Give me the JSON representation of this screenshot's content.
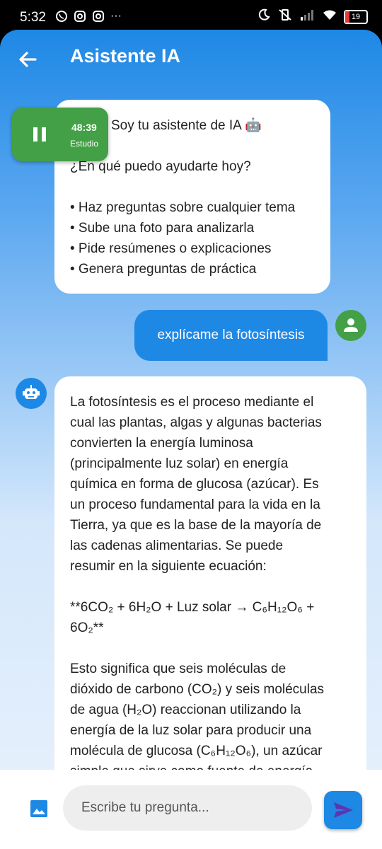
{
  "status_bar": {
    "time": "5:32",
    "left_icons": [
      "whatsapp-icon",
      "instagram-icon",
      "instagram-icon",
      "more-icon"
    ],
    "more": "···",
    "battery": "19"
  },
  "app_bar": {
    "title": "Asistente IA",
    "back_icon": "arrow-back-icon"
  },
  "timer": {
    "time": "48:39",
    "label": "Estudio"
  },
  "messages": {
    "greeting": {
      "line1": "Soy tu asistente de IA 🤖",
      "line2": "¿En qué puedo ayudarte hoy?",
      "bullets": [
        "• Haz preguntas sobre cualquier tema",
        "• Sube una foto para analizarla",
        "• Pide resúmenes o explicaciones",
        "• Genera preguntas de práctica"
      ]
    },
    "user": "explícame la fotosíntesis",
    "answer": {
      "p1_lines": [
        "La fotosíntesis es el proceso mediante el",
        "cual las plantas, algas y algunas bacterias",
        "convierten la energía luminosa",
        "(principalmente luz solar) en energía",
        "química en forma de glucosa (azúcar).  Es",
        "un proceso fundamental para la vida en la",
        "Tierra, ya que es la base de la mayoría de",
        "las cadenas alimentarias.  Se puede",
        "resumir en la siguiente ecuación:"
      ],
      "equation_line1": "**6CO₂ + 6H₂O + Luz solar → C₆H₁₂O₆ +",
      "equation_line2": "6O₂**",
      "p2_lines": [
        "Esto significa que seis moléculas de",
        "dióxido de carbono (CO₂) y seis moléculas",
        "de agua (H₂O) reaccionan utilizando la",
        "energía de la luz solar para producir una",
        "molécula de glucosa (C₆H₁₂O₆), un azúcar",
        "simple que sirve como fuente de energía"
      ]
    }
  },
  "input": {
    "placeholder": "Escribe tu pregunta..."
  },
  "colors": {
    "primary": "#1e88e5",
    "green": "#43a047"
  }
}
